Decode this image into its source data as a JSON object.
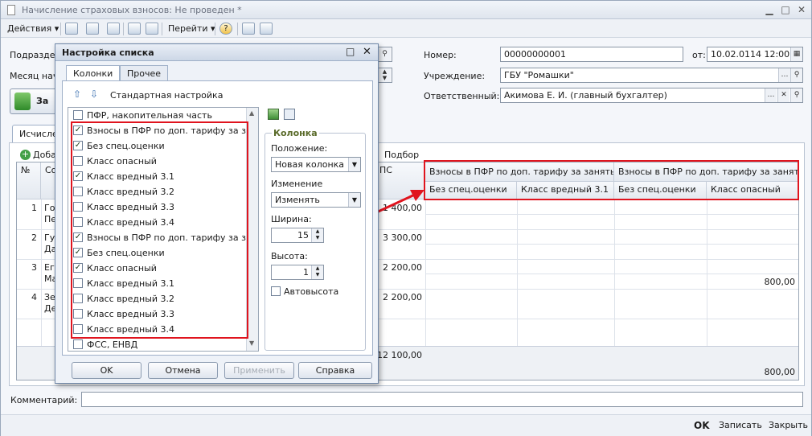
{
  "window": {
    "title": "Начисление страховых взносов: Не проведен *"
  },
  "toolbar": {
    "actions": "Действия",
    "goto": "Перейти",
    "help": "?"
  },
  "header": {
    "podrazdel_label": "Подраздел",
    "month_label": "Месяц начи",
    "number_label": "Номер:",
    "number_value": "00000000001",
    "date_label": "от:",
    "date_value": "10.02.0114 12:00:00",
    "institution_label": "Учреждение:",
    "institution_value": "ГБУ \"Ромашки\"",
    "responsible_label": "Ответственный:",
    "responsible_value": "Акимова Е. И. (главный бухгалтер)",
    "fill_button": "За"
  },
  "tabs": {
    "calc": "Исчислен"
  },
  "grid_toolbar": {
    "add": "Доба",
    "select": "Подбор"
  },
  "grid": {
    "col_no": "№",
    "col_emp": "Сот",
    "col_pfr": "ПС",
    "group1": "Взносы в ПФР по доп. тарифу за занятых ...",
    "group2": "Взносы в ПФР по доп. тарифу за занятых ...",
    "sub": [
      "Без спец.оценки",
      "Класс вредный 3.1",
      "Без спец.оценки",
      "Класс опасный"
    ],
    "rows": [
      {
        "no": "1",
        "name1": "Гор",
        "name2": "Пет",
        "pfr": "1 400,00",
        "last": ""
      },
      {
        "no": "2",
        "name1": "Гус",
        "name2": "Да",
        "pfr": "3 300,00",
        "last": ""
      },
      {
        "no": "3",
        "name1": "Его",
        "name2": "Ма",
        "pfr": "2 200,00",
        "last": "800,00"
      },
      {
        "no": "4",
        "name1": "Зем",
        "name2": "Де",
        "pfr": "2 200,00",
        "last": ""
      }
    ],
    "total_pfr": "12 100,00",
    "total_last": "800,00"
  },
  "comment": {
    "label": "Комментарий:",
    "value": ""
  },
  "footer": {
    "ok": "OK",
    "save": "Записать",
    "close": "Закрыть"
  },
  "dialog": {
    "title": "Настройка списка",
    "tab_columns": "Колонки",
    "tab_other": "Прочее",
    "standard": "Стандартная настройка",
    "items": [
      {
        "label": "ПФР, накопительная часть",
        "checked": false
      },
      {
        "label": "Взносы в ПФР по доп. тарифу за за...",
        "checked": true
      },
      {
        "label": "Без спец.оценки",
        "checked": true
      },
      {
        "label": "Класс опасный",
        "checked": false
      },
      {
        "label": "Класс вредный 3.1",
        "checked": true
      },
      {
        "label": "Класс вредный 3.2",
        "checked": false
      },
      {
        "label": "Класс вредный 3.3",
        "checked": false
      },
      {
        "label": "Класс вредный 3.4",
        "checked": false
      },
      {
        "label": "Взносы в ПФР по доп. тарифу за за...",
        "checked": true
      },
      {
        "label": "Без спец.оценки",
        "checked": true
      },
      {
        "label": "Класс опасный",
        "checked": true
      },
      {
        "label": "Класс вредный 3.1",
        "checked": false
      },
      {
        "label": "Класс вредный 3.2",
        "checked": false
      },
      {
        "label": "Класс вредный 3.3",
        "checked": false
      },
      {
        "label": "Класс вредный 3.4",
        "checked": false
      },
      {
        "label": "ФСС, ЕНВД",
        "checked": false
      }
    ],
    "column_group": "Колонка",
    "position_label": "Положение:",
    "position_value": "Новая колонка",
    "resize_label": "Изменение размера:",
    "resize_value": "Изменять",
    "width_label": "Ширина:",
    "width_value": "15",
    "height_label": "Высота:",
    "height_value": "1",
    "autoheight": "Автовысота",
    "btn_ok": "OK",
    "btn_cancel": "Отмена",
    "btn_apply": "Применить",
    "btn_help": "Справка"
  },
  "colors": {
    "annotation": "#e0141e",
    "accent": "#3a6fb0"
  }
}
